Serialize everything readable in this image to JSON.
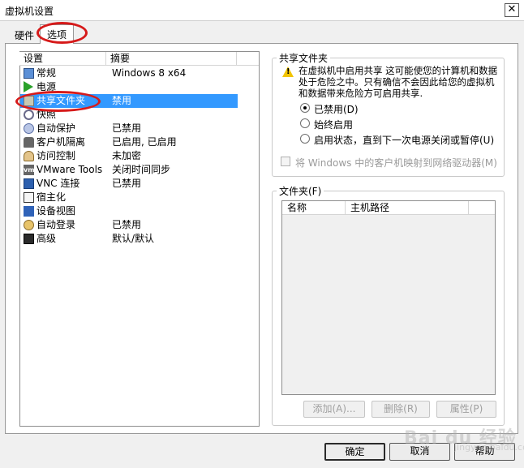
{
  "window": {
    "title": "虚拟机设置",
    "close_glyph": "✕"
  },
  "tabs": [
    {
      "label": "硬件"
    },
    {
      "label": "选项"
    }
  ],
  "settings_list": {
    "columns": [
      "设置",
      "摘要"
    ],
    "rows": [
      {
        "name": "常规",
        "summary": "Windows 8 x64",
        "icon": "monitor-icon"
      },
      {
        "name": "电源",
        "summary": "",
        "icon": "power-icon"
      },
      {
        "name": "共享文件夹",
        "summary": "禁用",
        "icon": "shared-folder-icon"
      },
      {
        "name": "快照",
        "summary": "",
        "icon": "snapshot-icon"
      },
      {
        "name": "自动保护",
        "summary": "已禁用",
        "icon": "autoprotect-icon"
      },
      {
        "name": "客户机隔离",
        "summary": "已启用, 已启用",
        "icon": "isolation-icon"
      },
      {
        "name": "访问控制",
        "summary": "未加密",
        "icon": "access-control-icon"
      },
      {
        "name": "VMware Tools",
        "summary": "关闭时间同步",
        "icon": "vmware-tools-icon"
      },
      {
        "name": "VNC 连接",
        "summary": "已禁用",
        "icon": "vnc-icon"
      },
      {
        "name": "宿主化",
        "summary": "",
        "icon": "guest-icon"
      },
      {
        "name": "设备视图",
        "summary": "",
        "icon": "device-view-icon"
      },
      {
        "name": "自动登录",
        "summary": "已禁用",
        "icon": "autologin-icon"
      },
      {
        "name": "高级",
        "summary": "默认/默认",
        "icon": "advanced-icon"
      }
    ]
  },
  "shared_folders": {
    "group_label": "共享文件夹",
    "warning": "在虚拟机中启用共享 这可能使您的计算机和数据处于危险之中。只有确信不会因此给您的虚拟机和数据带来危险方可启用共享.",
    "warning_glyph": "!",
    "options": [
      {
        "label": "已禁用(D)",
        "checked": true
      },
      {
        "label": "始终启用",
        "checked": false
      },
      {
        "label": "启用状态，直到下一次电源关闭或暂停(U)",
        "checked": false
      }
    ],
    "map_drive_label": "将 Windows 中的客户机映射到网络驱动器(M)"
  },
  "folders": {
    "group_label": "文件夹(F)",
    "columns": [
      "名称",
      "主机路径"
    ],
    "buttons": {
      "add": "添加(A)...",
      "remove": "删除(R)",
      "properties": "属性(P)"
    }
  },
  "footer": {
    "ok": "确定",
    "cancel": "取消",
    "help": "帮助"
  },
  "watermark": {
    "text": "Bai du 经验",
    "sub": "jingyan.baidu.com"
  },
  "colors": {
    "selection": "#3399ff",
    "annotation": "#d61a1a"
  }
}
